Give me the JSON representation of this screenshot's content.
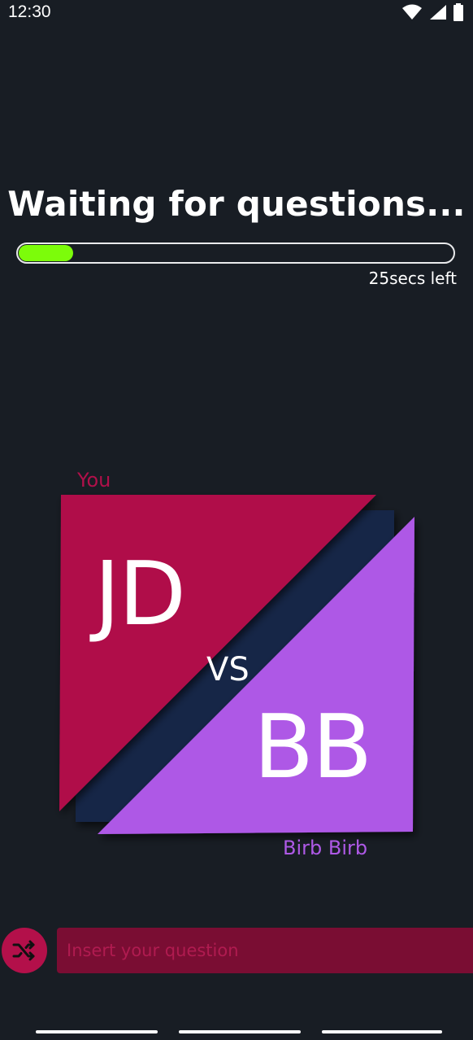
{
  "status_bar": {
    "time": "12:30",
    "icons": [
      "wifi-icon",
      "signal-icon",
      "battery-icon"
    ]
  },
  "header": {
    "title": "Waiting for questions...",
    "progress_fraction": 0.125,
    "time_left": "25secs left"
  },
  "versus": {
    "you_label": "You",
    "you_initials": "JD",
    "vs": "VS",
    "opponent_name": "Birb Birb",
    "opponent_initials": "BB"
  },
  "composer": {
    "placeholder": "Insert your question",
    "value": "",
    "shuffle_icon": "shuffle-icon"
  },
  "colors": {
    "background": "#181d24",
    "you_color": "#b0104a",
    "opponent_color": "#ae59e6",
    "divider_color": "#132547",
    "progress_color": "#7cfc0a",
    "input_background": "#7a0d33",
    "placeholder_color": "#b01b50"
  }
}
